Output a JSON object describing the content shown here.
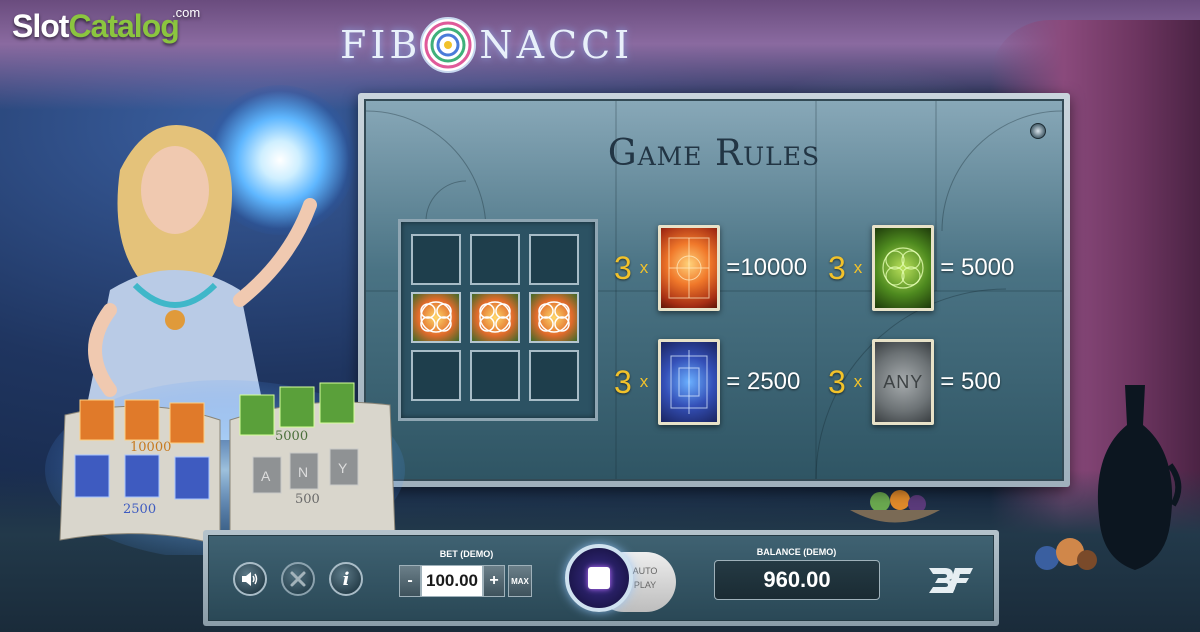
{
  "branding": {
    "watermark_part1": "Slot",
    "watermark_part2": "Catalog",
    "watermark_suffix": ".com",
    "game_title_left": "FIB",
    "game_title_right": "NACCI"
  },
  "rules": {
    "title": "Game Rules",
    "paytable": [
      {
        "count": "3",
        "x": "x",
        "symbol": "fire-card",
        "payout": "=10000"
      },
      {
        "count": "3",
        "x": "x",
        "symbol": "green-card",
        "payout": "= 5000"
      },
      {
        "count": "3",
        "x": "x",
        "symbol": "blue-card",
        "payout": "= 2500"
      },
      {
        "count": "3",
        "x": "x",
        "symbol": "any-card",
        "any_text": "ANY",
        "payout": "=  500"
      }
    ]
  },
  "book": {
    "payout_fire": "10000",
    "payout_green": "5000",
    "payout_blue": "2500",
    "payout_any": "500",
    "any_letters": [
      "A",
      "N",
      "Y"
    ]
  },
  "controls": {
    "bet_label": "BET (DEMO)",
    "bet_minus": "-",
    "bet_value": "100.00",
    "bet_plus": "+",
    "bet_max": "MAX",
    "auto_play": "AUTO PLAY",
    "balance_label": "BALANCE (DEMO)",
    "balance_value": "960.00",
    "info_label": "i"
  },
  "colors": {
    "accent_gold": "#f2c22a",
    "brand_green": "#8bc53f",
    "panel_teal": "#4a7384"
  }
}
